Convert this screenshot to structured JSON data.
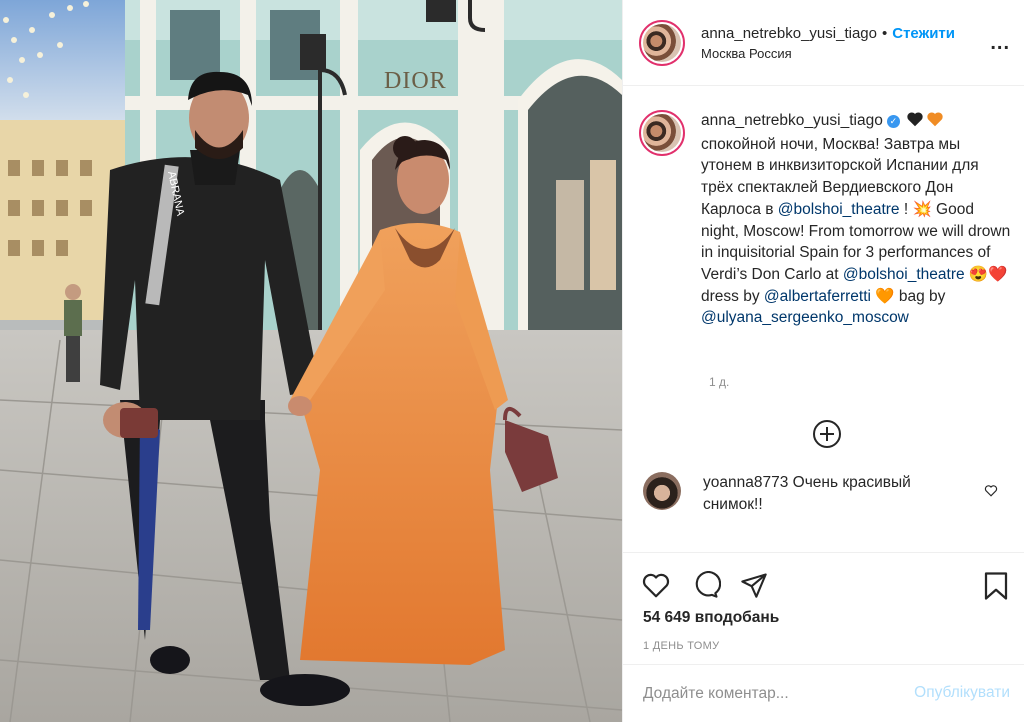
{
  "header": {
    "username": "anna_netrebko_yusi_tiago",
    "separator": "•",
    "follow_label": "Стежити",
    "location": "Москва Россия",
    "more_label": "..."
  },
  "caption": {
    "username": "anna_netrebko_yusi_tiago",
    "verified_mark": "✓",
    "text_1": "спокойной ночи, Москва! Завтра мы утонем в инквизиторской Испании для трёх спектаклей Вердиевского Дон Карлоса в ",
    "mention_1": "@bolshoi_theatre",
    "text_2": " ! 💥 Good night, Moscow! From tomorrow we will drown in inquisitorial Spain for 3 performances of Verdi’s Don Carlo at ",
    "mention_2": "@bolshoi_theatre",
    "text_3": " 😍❤️ dress by ",
    "mention_3": "@albertaferretti",
    "text_4": " 🧡 bag by ",
    "mention_4": "@ulyana_sergeenko_moscow",
    "time": "1 д."
  },
  "comment": {
    "username": "yoanna8773",
    "text": "Очень красивый снимок!!"
  },
  "actions": {
    "likes": "54 649 вподобань",
    "ago": "1 ДЕНЬ ТОМУ"
  },
  "add_comment": {
    "placeholder": "Додайте коментар...",
    "publish_label": "Опублікувати"
  },
  "photo": {
    "store_sign": "DIOR",
    "bag_text": "ABRANA"
  },
  "colors": {
    "follow": "#0095f6",
    "mention": "#00376b",
    "publish_disabled": "#b2dffc",
    "story_ring": "#e1306c"
  }
}
